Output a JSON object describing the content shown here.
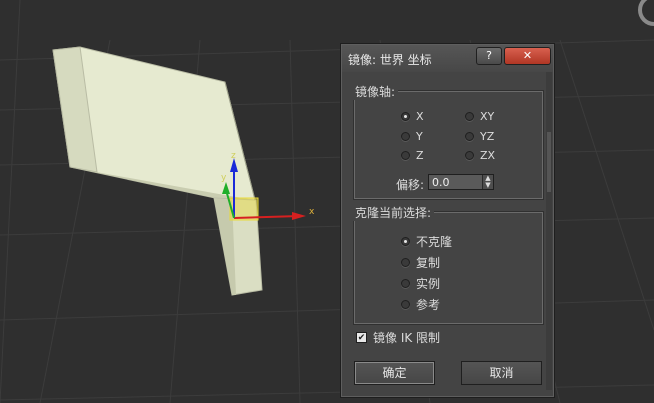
{
  "dialog": {
    "title": "镜像: 世界 坐标",
    "help_label": "?",
    "close_label": "✕",
    "axis_group": {
      "legend": "镜像轴:",
      "options": [
        {
          "label": "X",
          "selected": true
        },
        {
          "label": "Y",
          "selected": false
        },
        {
          "label": "Z",
          "selected": false
        },
        {
          "label": "XY",
          "selected": false
        },
        {
          "label": "YZ",
          "selected": false
        },
        {
          "label": "ZX",
          "selected": false
        }
      ],
      "offset_label": "偏移:",
      "offset_value": "0.0"
    },
    "clone_group": {
      "legend": "克隆当前选择:",
      "options": [
        {
          "label": "不克隆",
          "selected": true
        },
        {
          "label": "复制",
          "selected": false
        },
        {
          "label": "实例",
          "selected": false
        },
        {
          "label": "参考",
          "selected": false
        }
      ]
    },
    "ik_checkbox": {
      "label": "镜像 IK 限制",
      "checked": true
    },
    "ok_label": "确定",
    "cancel_label": "取消"
  },
  "viewport": {
    "gizmo_x_label": "x",
    "gizmo_y_label": "y",
    "gizmo_z_label": "z"
  },
  "colors": {
    "viewport_bg": "#2f2f2f",
    "dialog_bg": "#444444",
    "object_face": "#e9ecd2",
    "gizmo_x": "#d62020",
    "gizmo_y": "#1fae2a",
    "gizmo_z": "#1a2ad8",
    "gizmo_plane": "#e8d93a"
  }
}
